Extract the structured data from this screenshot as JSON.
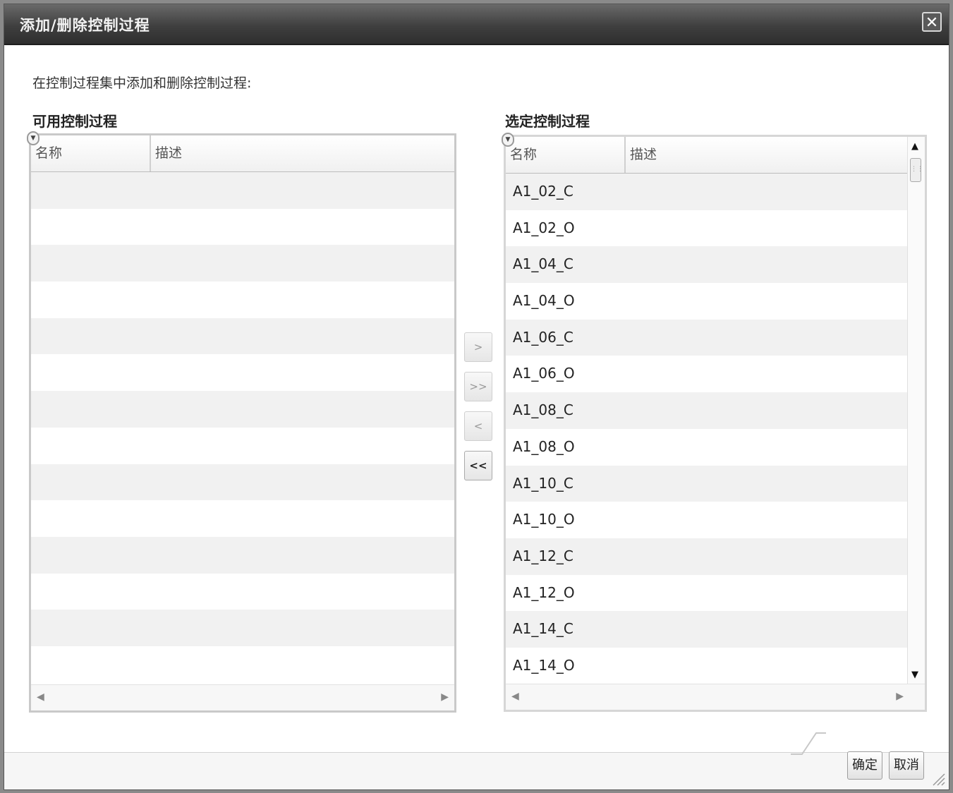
{
  "dialog": {
    "title": "添加/删除控制过程",
    "close_label": "✕",
    "instruction": "在控制过程集中添加和删除控制过程:"
  },
  "available": {
    "label": "可用控制过程",
    "columns": {
      "name": "名称",
      "description": "描述"
    },
    "rows": []
  },
  "selected": {
    "label": "选定控制过程",
    "columns": {
      "name": "名称",
      "description": "描述"
    },
    "rows": [
      {
        "name": "A1_02_C",
        "description": ""
      },
      {
        "name": "A1_02_O",
        "description": ""
      },
      {
        "name": "A1_04_C",
        "description": ""
      },
      {
        "name": "A1_04_O",
        "description": ""
      },
      {
        "name": "A1_06_C",
        "description": ""
      },
      {
        "name": "A1_06_O",
        "description": ""
      },
      {
        "name": "A1_08_C",
        "description": ""
      },
      {
        "name": "A1_08_O",
        "description": ""
      },
      {
        "name": "A1_10_C",
        "description": ""
      },
      {
        "name": "A1_10_O",
        "description": ""
      },
      {
        "name": "A1_12_C",
        "description": ""
      },
      {
        "name": "A1_12_O",
        "description": ""
      },
      {
        "name": "A1_14_C",
        "description": ""
      },
      {
        "name": "A1_14_O",
        "description": ""
      }
    ]
  },
  "move_buttons": {
    "add_one": ">",
    "add_all": ">>",
    "remove_one": "<",
    "remove_all": "<<"
  },
  "footer": {
    "ok_label": "确定",
    "cancel_label": "取消"
  }
}
